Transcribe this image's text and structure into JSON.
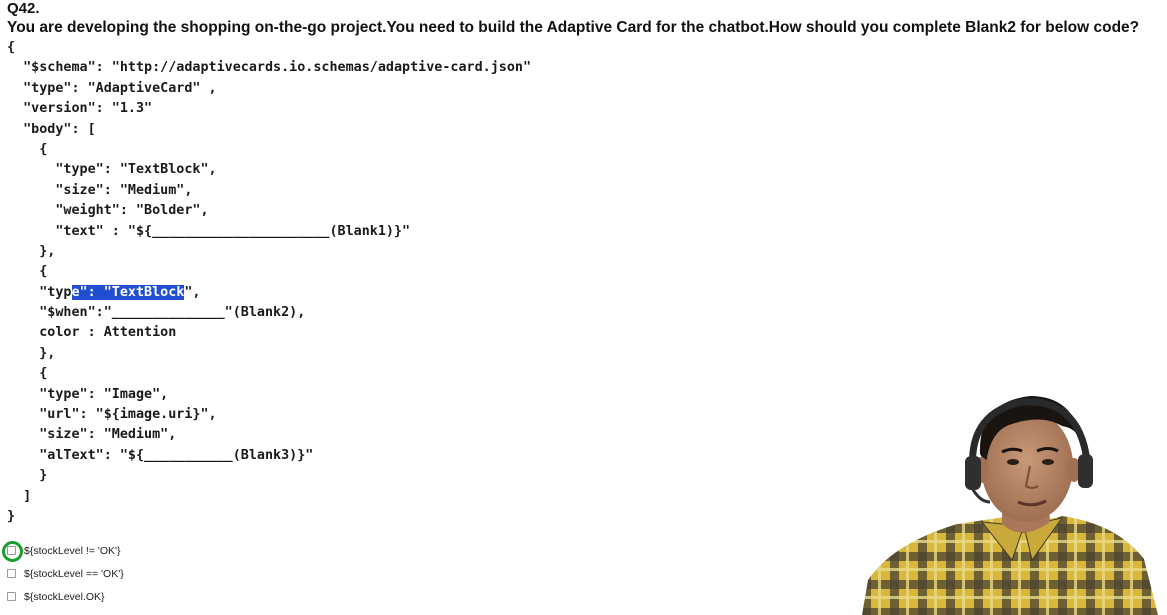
{
  "question": {
    "number": "Q42.",
    "text": "You are developing the shopping on-the-go project.You need to build the Adaptive Card for the chatbot.How should you complete Blank2 for below code?"
  },
  "code": {
    "lines": [
      "{",
      "  \"$schema\": \"http://adaptivecards.io.schemas/adaptive-card.json\"",
      "  \"type\": \"AdaptiveCard\" ,",
      "  \"version\": \"1.3\"",
      "  \"body\": [",
      "    {",
      "      \"type\": \"TextBlock\",",
      "      \"size\": \"Medium\",",
      "      \"weight\": \"Bolder\",",
      "      \"text\" : \"${______________________(Blank1)}\"",
      "    },",
      "    {",
      {
        "pre": "    \"typ",
        "hl": "e\": \"TextBlock",
        "post": "\","
      },
      "    \"$when\":\"______________\"(Blank2),",
      "    color : Attention",
      "    },",
      "    {",
      "    \"type\": \"Image\",",
      "    \"url\": \"${image.uri}\",",
      "    \"size\": \"Medium\",",
      "    \"alText\": \"${___________(Blank3)}\"",
      "    }",
      "  ]",
      "}"
    ]
  },
  "options": [
    {
      "label": "${stockLevel != 'OK'}",
      "checked": false,
      "highlighted": true
    },
    {
      "label": "${stockLevel == 'OK'}",
      "checked": false,
      "highlighted": false
    },
    {
      "label": "${stockLevel.OK}",
      "checked": false,
      "highlighted": false
    }
  ],
  "colors": {
    "highlight": "#1f4fd0",
    "answer_ring": "#1a9e2a",
    "shirt_yellow": "#d9b73a",
    "shirt_dark": "#3f3a2a"
  },
  "webcam": {
    "icon": "presenter-webcam"
  }
}
